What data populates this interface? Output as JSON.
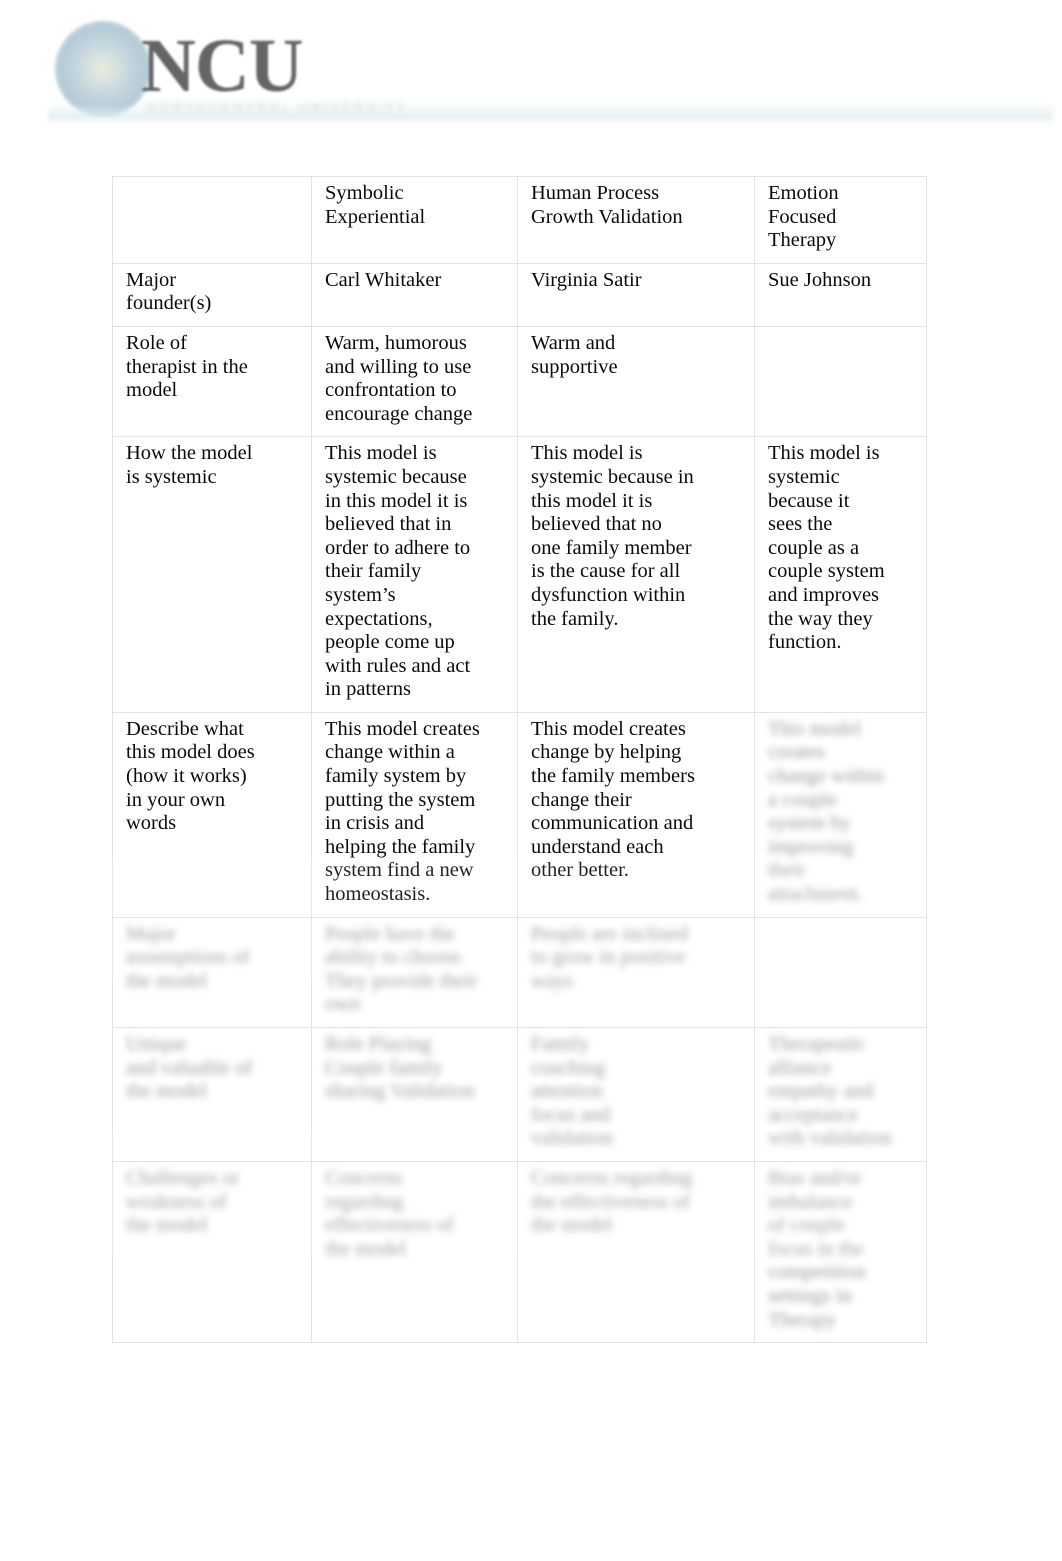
{
  "header": {
    "logo_mark_name": "ncu-circle-logo-mark",
    "logo_wordmark": "NCU",
    "logo_subtitle": "NORTHCENTRAL UNIVERSITY"
  },
  "table": {
    "columns": [
      {
        "key": "criteria",
        "header": ""
      },
      {
        "key": "symbolic",
        "header": "Symbolic\nExperiential"
      },
      {
        "key": "human_process",
        "header": "Human Process\nGrowth Validation"
      },
      {
        "key": "eft",
        "header": "Emotion\nFocused\nTherapy"
      }
    ],
    "rows": [
      {
        "name": "header-row",
        "redacted": false,
        "cells": [
          "",
          "Symbolic\nExperiential",
          "Human Process\nGrowth Validation",
          "Emotion\nFocused\nTherapy"
        ]
      },
      {
        "name": "major-founders-row",
        "redacted": false,
        "cells": [
          "Major\nfounder(s)",
          "Carl Whitaker",
          "Virginia Satir",
          "Sue Johnson"
        ]
      },
      {
        "name": "role-of-therapist-row",
        "redacted": false,
        "cells": [
          "Role of\ntherapist in the\nmodel",
          "Warm, humorous\nand willing to use\nconfrontation to\nencourage change",
          "Warm and\nsupportive",
          ""
        ]
      },
      {
        "name": "how-systemic-row",
        "redacted": false,
        "cells": [
          "How the model\nis systemic",
          "This model is\nsystemic because\nin this model it is\nbelieved that in\norder to adhere to\ntheir family\nsystem’s\nexpectations,\npeople come up\nwith rules and act\nin patterns",
          "This model is\nsystemic because in\nthis model it is\nbelieved that no\none family member\nis the cause for all\ndysfunction within\nthe family.",
          "This model is\nsystemic\nbecause it\nsees the\ncouple as a\ncouple system\nand improves\nthe way they\nfunction."
        ]
      },
      {
        "name": "describe-what-model-does-row",
        "redacted": false,
        "cells": [
          "Describe what\nthis model does\n(how it works)\nin your own\nwords",
          "This model creates\nchange within a\nfamily system by\nputting the system\nin crisis and\nhelping the family\nsystem find a new\nhomeostasis.",
          "This model creates\nchange by helping\nthe family members\nchange their\ncommunication and\nunderstand each\nother better.",
          "This model\ncreates\nchange within\na couple\nsystem by\nimproving\ntheir\nattachment."
        ],
        "cell_redactions": [
          false,
          false,
          false,
          true
        ]
      },
      {
        "name": "major-assumptions-row",
        "redacted": true,
        "cells": [
          "Major\nassumptions of\nthe model",
          "People have the\nability to choose.\nThey provide their\nown",
          "People are inclined\nto grow in positive\nways",
          ""
        ]
      },
      {
        "name": "unique-aspects-row",
        "redacted": true,
        "cells": [
          "Unique\nand valuable of\nthe model",
          "Role Playing\nCouple family\nsharing Validation",
          "Family\ncoaching\nattention\nfocus and\nvalidation",
          "Therapeutic\nalliance\nempathy and\nacceptance\nwith validation"
        ]
      },
      {
        "name": "challenges-row",
        "redacted": true,
        "cells": [
          "Challenges or\nweakness of\nthe model",
          "Concerns\nregarding\neffectiveness of\nthe model",
          "Concerns regarding\nthe effectiveness of\nthe model",
          "Bias and/or\nimbalance\nof couple\nfocus in the\ncompetition\nsettings in\nTherapy"
        ]
      }
    ]
  }
}
